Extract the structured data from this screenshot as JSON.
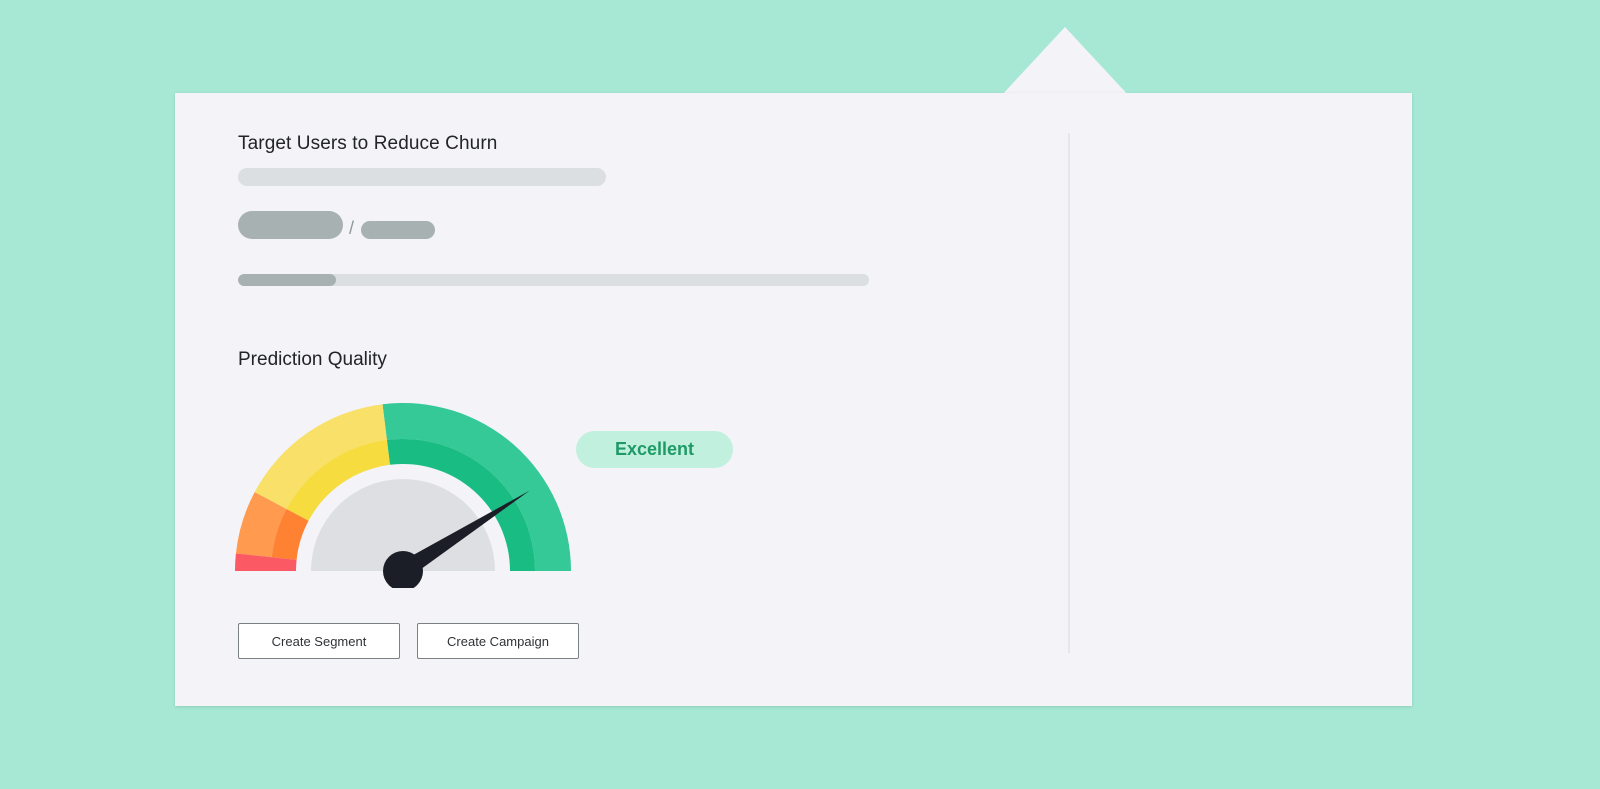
{
  "card": {
    "title": "Target Users to Reduce Churn",
    "skeleton": {
      "separator": "/",
      "progress_fraction": 0.155
    }
  },
  "prediction": {
    "title": "Prediction Quality",
    "rating": "Excellent",
    "gauge_value_fraction": 0.82,
    "colors": {
      "red": "#fb5a64",
      "orange_outer": "#ff9a4f",
      "orange_inner": "#ff8232",
      "yellow_outer": "#f9e068",
      "yellow_inner": "#f6dc3e",
      "green_outer": "#34c997",
      "green_inner": "#19bc83",
      "needle": "#1b1e26",
      "hub": "#dddfe2"
    }
  },
  "actions": {
    "create_segment": "Create Segment",
    "create_campaign": "Create Campaign"
  }
}
